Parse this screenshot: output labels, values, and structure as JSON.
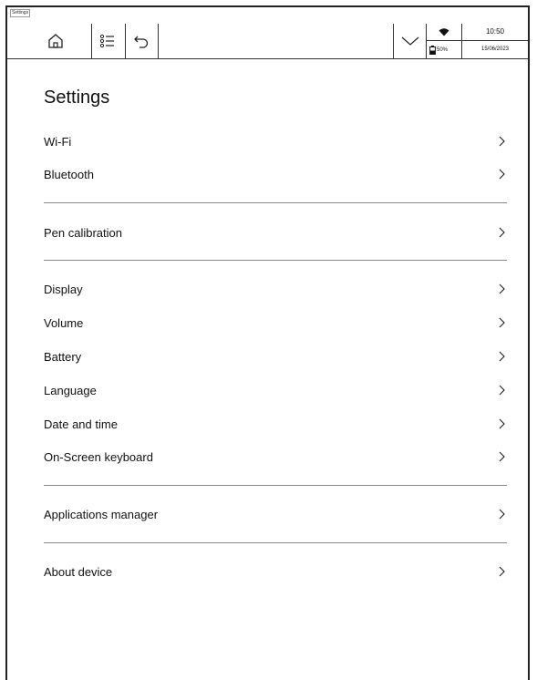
{
  "statusbar": {
    "tab_label": "Settings",
    "time": "10:50",
    "date": "15/06/2023",
    "battery": "50%"
  },
  "page": {
    "title": "Settings"
  },
  "groups": [
    [
      "Wi-Fi",
      "Bluetooth"
    ],
    [
      "Pen calibration"
    ],
    [
      "Display",
      "Volume",
      "Battery",
      "Language",
      "Date and time",
      "On-Screen keyboard"
    ],
    [
      "Applications manager"
    ],
    [
      "About device"
    ]
  ],
  "icons": {
    "home": "home-icon",
    "list": "list-icon",
    "back": "undo-icon",
    "dropdown": "chevron-down-icon",
    "wifi": "wifi-icon",
    "battery": "battery-icon",
    "row": "chevron-right-icon"
  }
}
